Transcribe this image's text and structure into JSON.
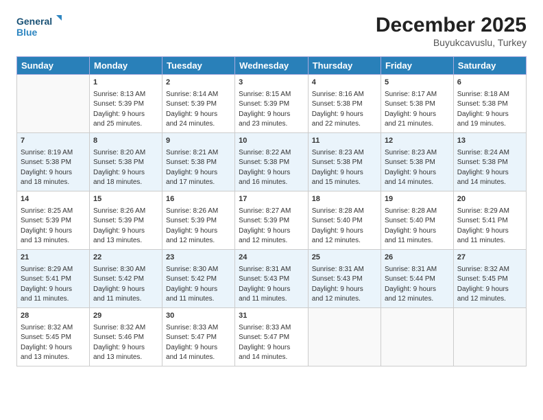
{
  "header": {
    "logo_line1": "General",
    "logo_line2": "Blue",
    "month_title": "December 2025",
    "location": "Buyukcavuslu, Turkey"
  },
  "days_of_week": [
    "Sunday",
    "Monday",
    "Tuesday",
    "Wednesday",
    "Thursday",
    "Friday",
    "Saturday"
  ],
  "weeks": [
    [
      {
        "day": "",
        "info": ""
      },
      {
        "day": "1",
        "info": "Sunrise: 8:13 AM\nSunset: 5:39 PM\nDaylight: 9 hours\nand 25 minutes."
      },
      {
        "day": "2",
        "info": "Sunrise: 8:14 AM\nSunset: 5:39 PM\nDaylight: 9 hours\nand 24 minutes."
      },
      {
        "day": "3",
        "info": "Sunrise: 8:15 AM\nSunset: 5:39 PM\nDaylight: 9 hours\nand 23 minutes."
      },
      {
        "day": "4",
        "info": "Sunrise: 8:16 AM\nSunset: 5:38 PM\nDaylight: 9 hours\nand 22 minutes."
      },
      {
        "day": "5",
        "info": "Sunrise: 8:17 AM\nSunset: 5:38 PM\nDaylight: 9 hours\nand 21 minutes."
      },
      {
        "day": "6",
        "info": "Sunrise: 8:18 AM\nSunset: 5:38 PM\nDaylight: 9 hours\nand 19 minutes."
      }
    ],
    [
      {
        "day": "7",
        "info": "Sunrise: 8:19 AM\nSunset: 5:38 PM\nDaylight: 9 hours\nand 18 minutes."
      },
      {
        "day": "8",
        "info": "Sunrise: 8:20 AM\nSunset: 5:38 PM\nDaylight: 9 hours\nand 18 minutes."
      },
      {
        "day": "9",
        "info": "Sunrise: 8:21 AM\nSunset: 5:38 PM\nDaylight: 9 hours\nand 17 minutes."
      },
      {
        "day": "10",
        "info": "Sunrise: 8:22 AM\nSunset: 5:38 PM\nDaylight: 9 hours\nand 16 minutes."
      },
      {
        "day": "11",
        "info": "Sunrise: 8:23 AM\nSunset: 5:38 PM\nDaylight: 9 hours\nand 15 minutes."
      },
      {
        "day": "12",
        "info": "Sunrise: 8:23 AM\nSunset: 5:38 PM\nDaylight: 9 hours\nand 14 minutes."
      },
      {
        "day": "13",
        "info": "Sunrise: 8:24 AM\nSunset: 5:38 PM\nDaylight: 9 hours\nand 14 minutes."
      }
    ],
    [
      {
        "day": "14",
        "info": "Sunrise: 8:25 AM\nSunset: 5:39 PM\nDaylight: 9 hours\nand 13 minutes."
      },
      {
        "day": "15",
        "info": "Sunrise: 8:26 AM\nSunset: 5:39 PM\nDaylight: 9 hours\nand 13 minutes."
      },
      {
        "day": "16",
        "info": "Sunrise: 8:26 AM\nSunset: 5:39 PM\nDaylight: 9 hours\nand 12 minutes."
      },
      {
        "day": "17",
        "info": "Sunrise: 8:27 AM\nSunset: 5:39 PM\nDaylight: 9 hours\nand 12 minutes."
      },
      {
        "day": "18",
        "info": "Sunrise: 8:28 AM\nSunset: 5:40 PM\nDaylight: 9 hours\nand 12 minutes."
      },
      {
        "day": "19",
        "info": "Sunrise: 8:28 AM\nSunset: 5:40 PM\nDaylight: 9 hours\nand 11 minutes."
      },
      {
        "day": "20",
        "info": "Sunrise: 8:29 AM\nSunset: 5:41 PM\nDaylight: 9 hours\nand 11 minutes."
      }
    ],
    [
      {
        "day": "21",
        "info": "Sunrise: 8:29 AM\nSunset: 5:41 PM\nDaylight: 9 hours\nand 11 minutes."
      },
      {
        "day": "22",
        "info": "Sunrise: 8:30 AM\nSunset: 5:42 PM\nDaylight: 9 hours\nand 11 minutes."
      },
      {
        "day": "23",
        "info": "Sunrise: 8:30 AM\nSunset: 5:42 PM\nDaylight: 9 hours\nand 11 minutes."
      },
      {
        "day": "24",
        "info": "Sunrise: 8:31 AM\nSunset: 5:43 PM\nDaylight: 9 hours\nand 11 minutes."
      },
      {
        "day": "25",
        "info": "Sunrise: 8:31 AM\nSunset: 5:43 PM\nDaylight: 9 hours\nand 12 minutes."
      },
      {
        "day": "26",
        "info": "Sunrise: 8:31 AM\nSunset: 5:44 PM\nDaylight: 9 hours\nand 12 minutes."
      },
      {
        "day": "27",
        "info": "Sunrise: 8:32 AM\nSunset: 5:45 PM\nDaylight: 9 hours\nand 12 minutes."
      }
    ],
    [
      {
        "day": "28",
        "info": "Sunrise: 8:32 AM\nSunset: 5:45 PM\nDaylight: 9 hours\nand 13 minutes."
      },
      {
        "day": "29",
        "info": "Sunrise: 8:32 AM\nSunset: 5:46 PM\nDaylight: 9 hours\nand 13 minutes."
      },
      {
        "day": "30",
        "info": "Sunrise: 8:33 AM\nSunset: 5:47 PM\nDaylight: 9 hours\nand 14 minutes."
      },
      {
        "day": "31",
        "info": "Sunrise: 8:33 AM\nSunset: 5:47 PM\nDaylight: 9 hours\nand 14 minutes."
      },
      {
        "day": "",
        "info": ""
      },
      {
        "day": "",
        "info": ""
      },
      {
        "day": "",
        "info": ""
      }
    ]
  ]
}
